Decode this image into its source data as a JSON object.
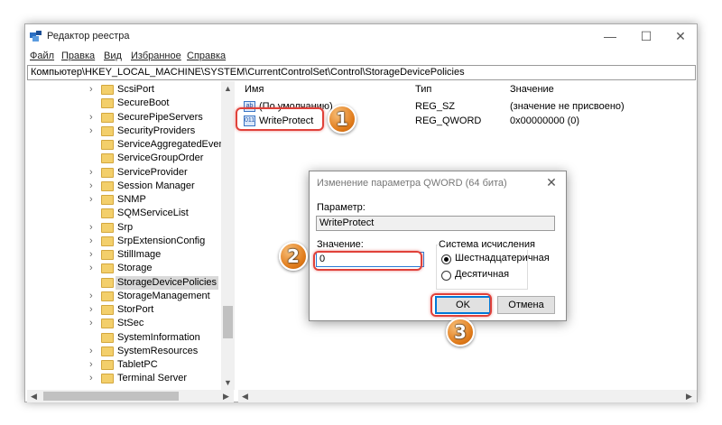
{
  "window": {
    "title": "Редактор реестра",
    "minimize_glyph": "—",
    "maximize_glyph": "☐",
    "close_glyph": "✕"
  },
  "menu": [
    "Файл",
    "Правка",
    "Вид",
    "Избранное",
    "Справка"
  ],
  "address": "Компьютер\\HKEY_LOCAL_MACHINE\\SYSTEM\\CurrentControlSet\\Control\\StorageDevicePolicies",
  "tree": {
    "items": [
      {
        "label": "ScsiPort",
        "expandable": true
      },
      {
        "label": "SecureBoot",
        "expandable": false
      },
      {
        "label": "SecurePipeServers",
        "expandable": true
      },
      {
        "label": "SecurityProviders",
        "expandable": true
      },
      {
        "label": "ServiceAggregatedEvents",
        "expandable": false
      },
      {
        "label": "ServiceGroupOrder",
        "expandable": false
      },
      {
        "label": "ServiceProvider",
        "expandable": true
      },
      {
        "label": "Session Manager",
        "expandable": true
      },
      {
        "label": "SNMP",
        "expandable": true
      },
      {
        "label": "SQMServiceList",
        "expandable": false
      },
      {
        "label": "Srp",
        "expandable": true
      },
      {
        "label": "SrpExtensionConfig",
        "expandable": true
      },
      {
        "label": "StillImage",
        "expandable": true
      },
      {
        "label": "Storage",
        "expandable": true
      },
      {
        "label": "StorageDevicePolicies",
        "expandable": false,
        "selected": true
      },
      {
        "label": "StorageManagement",
        "expandable": true
      },
      {
        "label": "StorPort",
        "expandable": true
      },
      {
        "label": "StSec",
        "expandable": true
      },
      {
        "label": "SystemInformation",
        "expandable": false
      },
      {
        "label": "SystemResources",
        "expandable": true
      },
      {
        "label": "TabletPC",
        "expandable": true
      },
      {
        "label": "Terminal Server",
        "expandable": true
      }
    ]
  },
  "list": {
    "headers": {
      "name": "Имя",
      "type": "Тип",
      "value": "Значение"
    },
    "rows": [
      {
        "name": "(По умолчанию)",
        "type": "REG_SZ",
        "value": "(значение не присвоено)",
        "icon": "ab"
      },
      {
        "name": "WriteProtect",
        "type": "REG_QWORD",
        "value": "0x00000000 (0)",
        "icon": "011"
      }
    ]
  },
  "dialog": {
    "title": "Изменение параметра QWORD (64 бита)",
    "close_glyph": "✕",
    "param_label": "Параметр:",
    "param_value": "WriteProtect",
    "value_label": "Значение:",
    "value_input": "0",
    "base_label": "Система исчисления",
    "radio_hex": "Шестнадцатеричная",
    "radio_dec": "Десятичная",
    "selected_base": "hex",
    "ok_label": "OK",
    "cancel_label": "Отмена"
  },
  "annotations": {
    "step1": "1",
    "step2": "2",
    "step3": "3",
    "color": "#e07b1a",
    "highlight_color": "#e0413a"
  }
}
